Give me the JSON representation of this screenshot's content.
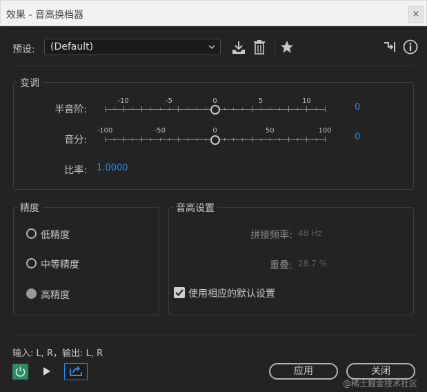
{
  "window": {
    "title": "效果 - 音高换档器",
    "close_glyph": "×"
  },
  "preset": {
    "label": "预设:",
    "value": "(Default)",
    "icons": [
      "download-icon",
      "trash-icon",
      "star-icon",
      "routing-icon",
      "info-icon"
    ]
  },
  "transpose": {
    "group_title": "变调",
    "semitones": {
      "label": "半音阶:",
      "ticks": [
        "-10",
        "-5",
        "0",
        "5",
        "10"
      ],
      "value": "0",
      "range": [
        -12,
        12
      ],
      "current": 0
    },
    "cents": {
      "label": "音分:",
      "ticks": [
        "-100",
        "-50",
        "0",
        "50",
        "100"
      ],
      "value": "0",
      "range": [
        -100,
        100
      ],
      "current": 0
    },
    "ratio": {
      "label": "比率:",
      "value": "1.0000"
    }
  },
  "precision": {
    "group_title": "精度",
    "options": [
      {
        "label": "低精度",
        "selected": false
      },
      {
        "label": "中等精度",
        "selected": false
      },
      {
        "label": "高精度",
        "selected": true
      }
    ]
  },
  "pitch_settings": {
    "group_title": "音高设置",
    "splice_freq": {
      "label": "拼接频率:",
      "value": "48 Hz"
    },
    "overlap": {
      "label": "重叠:",
      "value": "28.7 %"
    },
    "default_checkbox": {
      "label": "使用相应的默认设置",
      "checked": true
    }
  },
  "footer": {
    "io_text": "输入: L, R，输出: L, R",
    "apply_label": "应用",
    "close_label": "关闭"
  },
  "watermark": "@稀土掘金技术社区",
  "colors": {
    "accent": "#2d8ceb",
    "power": "#2e8a62",
    "background": "#232323"
  }
}
